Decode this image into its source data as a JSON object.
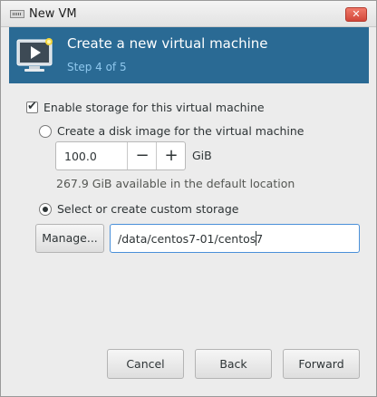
{
  "window": {
    "title": "New VM",
    "close_label": "✕"
  },
  "header": {
    "title": "Create a new virtual machine",
    "step": "Step 4 of 5"
  },
  "storage": {
    "enable_label": "Enable storage for this virtual machine",
    "enable_checked": true,
    "option_disk_image_label": "Create a disk image for the virtual machine",
    "disk_size_value": "100.0",
    "disk_size_unit": "GiB",
    "decrement_label": "−",
    "increment_label": "+",
    "available_text": "267.9 GiB available in the default location",
    "option_custom_label": "Select or create custom storage",
    "selected_option": "custom",
    "manage_button_label": "Manage...",
    "custom_path_value": "/data/centos7-01/centos7"
  },
  "footer": {
    "cancel_label": "Cancel",
    "back_label": "Back",
    "forward_label": "Forward"
  },
  "colors": {
    "header_band": "#2a6a94",
    "step_text": "#8fc8ee",
    "focus_border": "#4a90d9"
  }
}
